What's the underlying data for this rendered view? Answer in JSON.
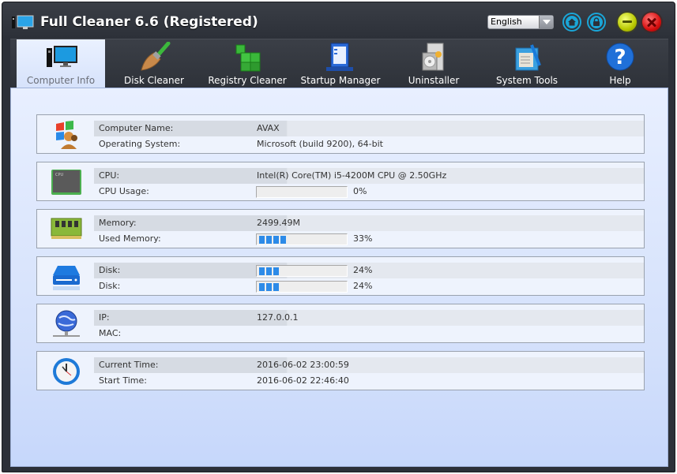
{
  "window": {
    "title": "Full Cleaner 6.6 (Registered)",
    "language": "English",
    "buttons": [
      "home",
      "lock",
      "minimize",
      "close"
    ]
  },
  "toolbar": {
    "items": [
      {
        "label": "Computer Info",
        "icon": "computer-icon",
        "active": true
      },
      {
        "label": "Disk Cleaner",
        "icon": "broom-icon",
        "active": false
      },
      {
        "label": "Registry Cleaner",
        "icon": "registry-cubes-icon",
        "active": false
      },
      {
        "label": "Startup Manager",
        "icon": "startup-window-icon",
        "active": false
      },
      {
        "label": "Uninstaller",
        "icon": "software-box-icon",
        "active": false
      },
      {
        "label": "System Tools",
        "icon": "tools-icon",
        "active": false
      },
      {
        "label": "Help",
        "icon": "help-icon",
        "active": false
      }
    ]
  },
  "panels": {
    "system": {
      "icon": "windows-users-icon",
      "computer_name_label": "Computer Name:",
      "computer_name": "AVAX",
      "os_label": "Operating System:",
      "os": "Microsoft   (build 9200), 64-bit"
    },
    "cpu": {
      "icon": "cpu-chip-icon",
      "cpu_label": "CPU:",
      "cpu": "Intel(R) Core(TM) i5-4200M CPU @ 2.50GHz",
      "usage_label": "CPU Usage:",
      "usage_percent": 0,
      "usage_text": "0%"
    },
    "memory": {
      "icon": "memory-module-icon",
      "memory_label": "Memory:",
      "memory": "2499.49M",
      "used_label": "Used Memory:",
      "used_percent": 33,
      "used_text": "33%"
    },
    "disk": {
      "icon": "hard-disk-icon",
      "disks": [
        {
          "label": "Disk:",
          "percent": 24,
          "text": "24%"
        },
        {
          "label": "Disk:",
          "percent": 24,
          "text": "24%"
        }
      ]
    },
    "network": {
      "icon": "network-globe-icon",
      "ip_label": "IP:",
      "ip": "127.0.0.1",
      "mac_label": "MAC:",
      "mac": ""
    },
    "time": {
      "icon": "clock-icon",
      "current_label": "Current Time:",
      "current": "2016-06-02  23:00:59",
      "start_label": "Start Time:",
      "start": "2016-06-02  22:46:40"
    }
  },
  "colors": {
    "progress": "#2d8be8",
    "accent": "#1aa6d8"
  }
}
